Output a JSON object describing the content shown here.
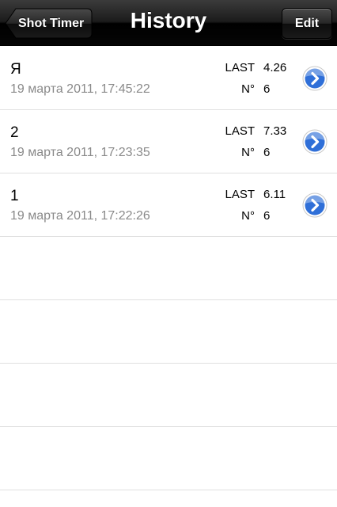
{
  "navbar": {
    "title": "History",
    "back_label": "Shot Timer",
    "edit_label": "Edit"
  },
  "columns": {
    "last_label": "LAST",
    "number_label": "N°"
  },
  "history": [
    {
      "name": "Я",
      "date": "19 марта 2011, 17:45:22",
      "last": "4.26",
      "number": "6"
    },
    {
      "name": "2",
      "date": "19 марта 2011, 17:23:35",
      "last": "7.33",
      "number": "6"
    },
    {
      "name": "1",
      "date": "19 марта 2011, 17:22:26",
      "last": "6.11",
      "number": "6"
    }
  ],
  "icons": {
    "detail_disclosure": "chevron-right-icon",
    "back_arrow": "back-arrow-icon"
  },
  "colors": {
    "navbar": "#000000",
    "disclosure_blue": "#2f6fd8",
    "date_gray": "#8a8a8a",
    "separator": "#e0e0e0"
  }
}
